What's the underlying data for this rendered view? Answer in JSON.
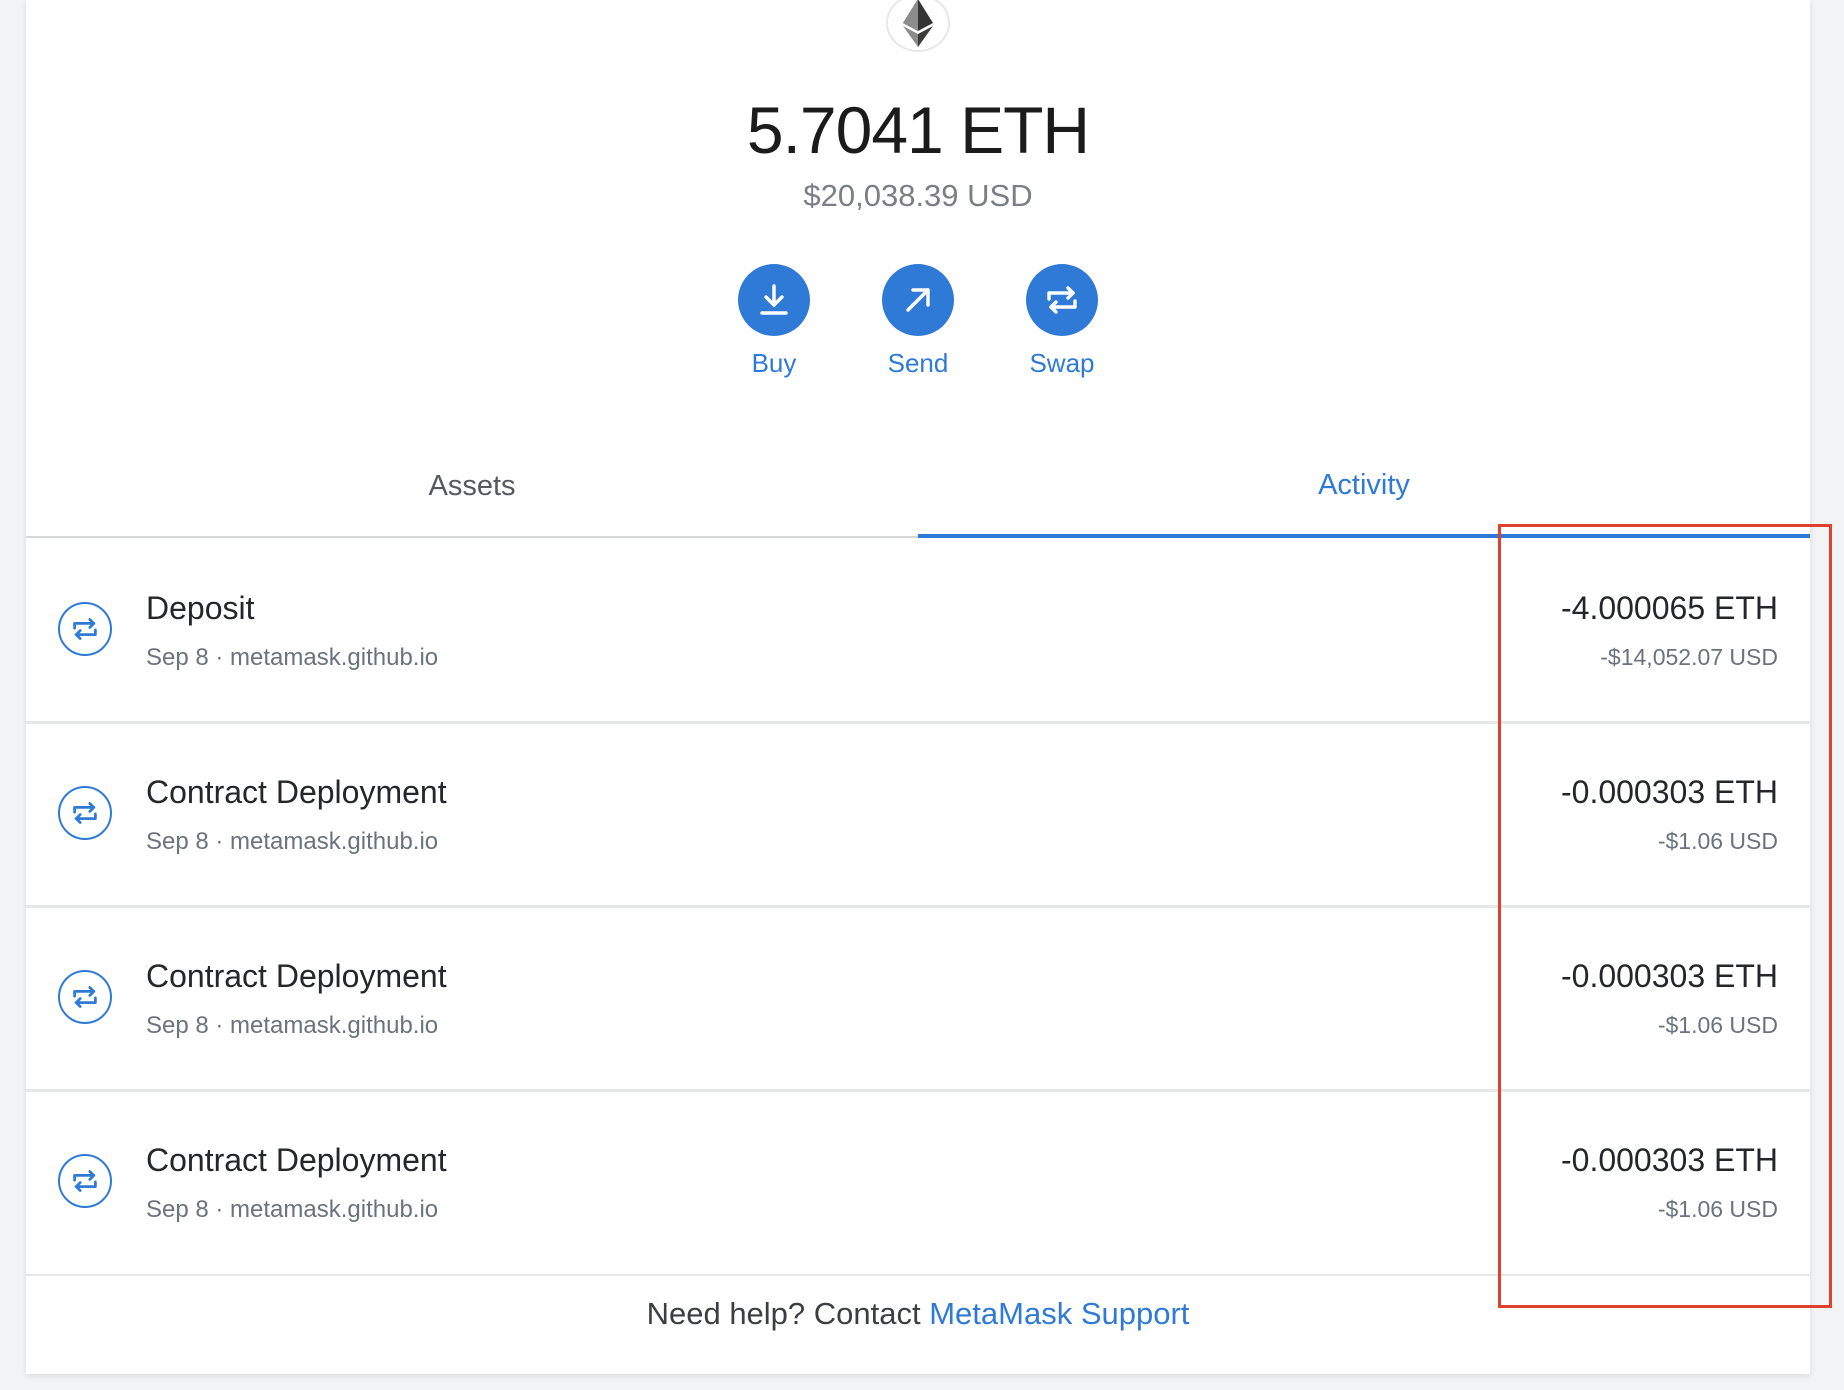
{
  "token": {
    "icon": "ethereum-logo"
  },
  "balance": {
    "eth": "5.7041 ETH",
    "usd": "$20,038.39 USD"
  },
  "actions": [
    {
      "label": "Buy",
      "icon": "download-arrow-icon"
    },
    {
      "label": "Send",
      "icon": "arrow-up-right-icon"
    },
    {
      "label": "Swap",
      "icon": "swap-arrows-icon"
    }
  ],
  "tabs": [
    {
      "label": "Assets",
      "active": false
    },
    {
      "label": "Activity",
      "active": true
    }
  ],
  "transactions": [
    {
      "title": "Deposit",
      "date": "Sep 8",
      "origin": "metamask.github.io",
      "amount": "-4.000065 ETH",
      "fiat": "-$14,052.07 USD"
    },
    {
      "title": "Contract Deployment",
      "date": "Sep 8",
      "origin": "metamask.github.io",
      "amount": "-0.000303 ETH",
      "fiat": "-$1.06 USD"
    },
    {
      "title": "Contract Deployment",
      "date": "Sep 8",
      "origin": "metamask.github.io",
      "amount": "-0.000303 ETH",
      "fiat": "-$1.06 USD"
    },
    {
      "title": "Contract Deployment",
      "date": "Sep 8",
      "origin": "metamask.github.io",
      "amount": "-0.000303 ETH",
      "fiat": "-$1.06 USD"
    }
  ],
  "help": {
    "prefix": "Need help? Contact ",
    "link": "MetaMask Support"
  },
  "colors": {
    "accent": "#2f7ad6",
    "highlight": "#e0402f"
  }
}
